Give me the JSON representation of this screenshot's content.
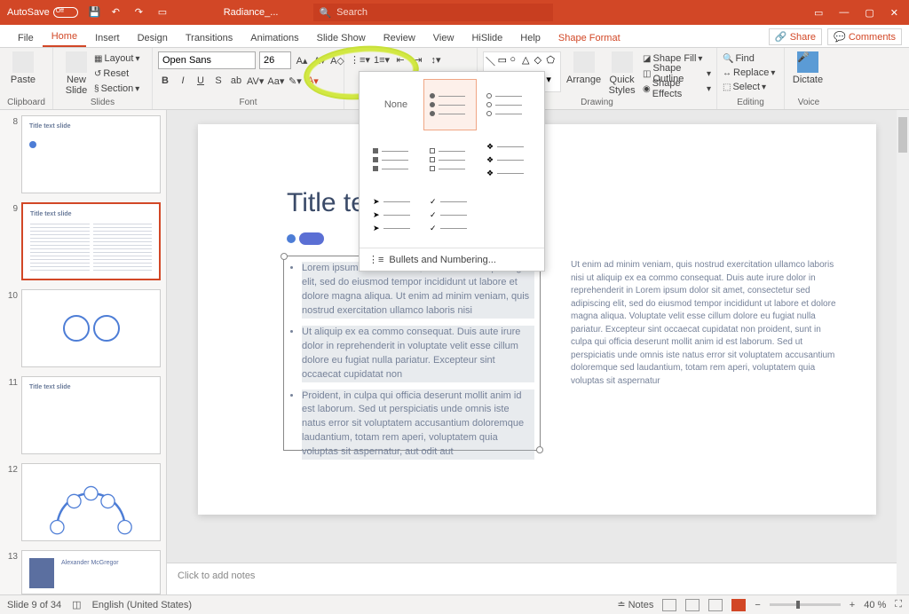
{
  "title_bar": {
    "autosave_label": "AutoSave",
    "autosave_state": "Off",
    "filename": "Radiance_...",
    "search_placeholder": "Search"
  },
  "tabs": {
    "file": "File",
    "home": "Home",
    "insert": "Insert",
    "design": "Design",
    "transitions": "Transitions",
    "animations": "Animations",
    "slideshow": "Slide Show",
    "review": "Review",
    "view": "View",
    "hislide": "HiSlide",
    "help": "Help",
    "shape_format": "Shape Format",
    "share": "Share",
    "comments": "Comments"
  },
  "ribbon": {
    "clipboard": {
      "label": "Clipboard",
      "paste": "Paste"
    },
    "slides": {
      "label": "Slides",
      "new_slide": "New\nSlide",
      "layout": "Layout",
      "reset": "Reset",
      "section": "Section"
    },
    "font": {
      "label": "Font",
      "font_name": "Open Sans",
      "font_size": "26"
    },
    "drawing": {
      "label": "Drawing",
      "arrange": "Arrange",
      "quick_styles": "Quick\nStyles",
      "shape_fill": "Shape Fill",
      "shape_outline": "Shape Outline",
      "shape_effects": "Shape Effects"
    },
    "editing": {
      "label": "Editing",
      "find": "Find",
      "replace": "Replace",
      "select": "Select"
    },
    "voice": {
      "label": "Voice",
      "dictate": "Dictate"
    }
  },
  "bullet_menu": {
    "none_label": "None",
    "footer": "Bullets and Numbering..."
  },
  "slide": {
    "title": "Title text",
    "left_list": [
      "Lorem ipsum dolor sit amet, consectetur adipiscing elit, sed do eiusmod tempor incididunt ut labore et dolore magna aliqua. Ut enim ad minim veniam, quis nostrud exercitation ullamco laboris nisi",
      "Ut aliquip ex ea commo consequat. Duis aute irure dolor in reprehenderit in voluptate velit esse cillum dolore eu fugiat nulla pariatur. Excepteur sint occaecat cupidatat non",
      "Proident, in culpa qui officia deserunt mollit anim id est laborum. Sed ut perspiciatis unde omnis iste natus error sit voluptatem accusantium doloremque laudantium, totam rem aperi, voluptatem quia voluptas sit aspernatur, aut odit aut"
    ],
    "right_text": "Ut enim ad minim veniam, quis nostrud exercitation ullamco laboris nisi ut aliquip ex ea commo consequat. Duis aute irure dolor in reprehenderit in Lorem ipsum dolor sit amet, consectetur sed adipiscing elit, sed do eiusmod tempor incididunt ut labore et dolore magna aliqua. Voluptate velit esse cillum dolore eu fugiat nulla pariatur. Excepteur sint occaecat cupidatat non proident, sunt in culpa qui officia deserunt mollit anim id est laborum. Sed ut perspiciatis unde omnis iste natus error sit voluptatem accusantium doloremque sed laudantium, totam rem aperi, voluptatem quia voluptas sit aspernatur"
  },
  "thumbnails": {
    "t8": "Title text slide",
    "t9": "Title text slide",
    "t11": "Title text slide",
    "t13": "Alexander McGregor"
  },
  "notes": {
    "placeholder": "Click to add notes"
  },
  "status": {
    "slide_counter": "Slide 9 of 34",
    "language": "English (United States)",
    "notes_btn": "Notes",
    "zoom": "40 %"
  }
}
